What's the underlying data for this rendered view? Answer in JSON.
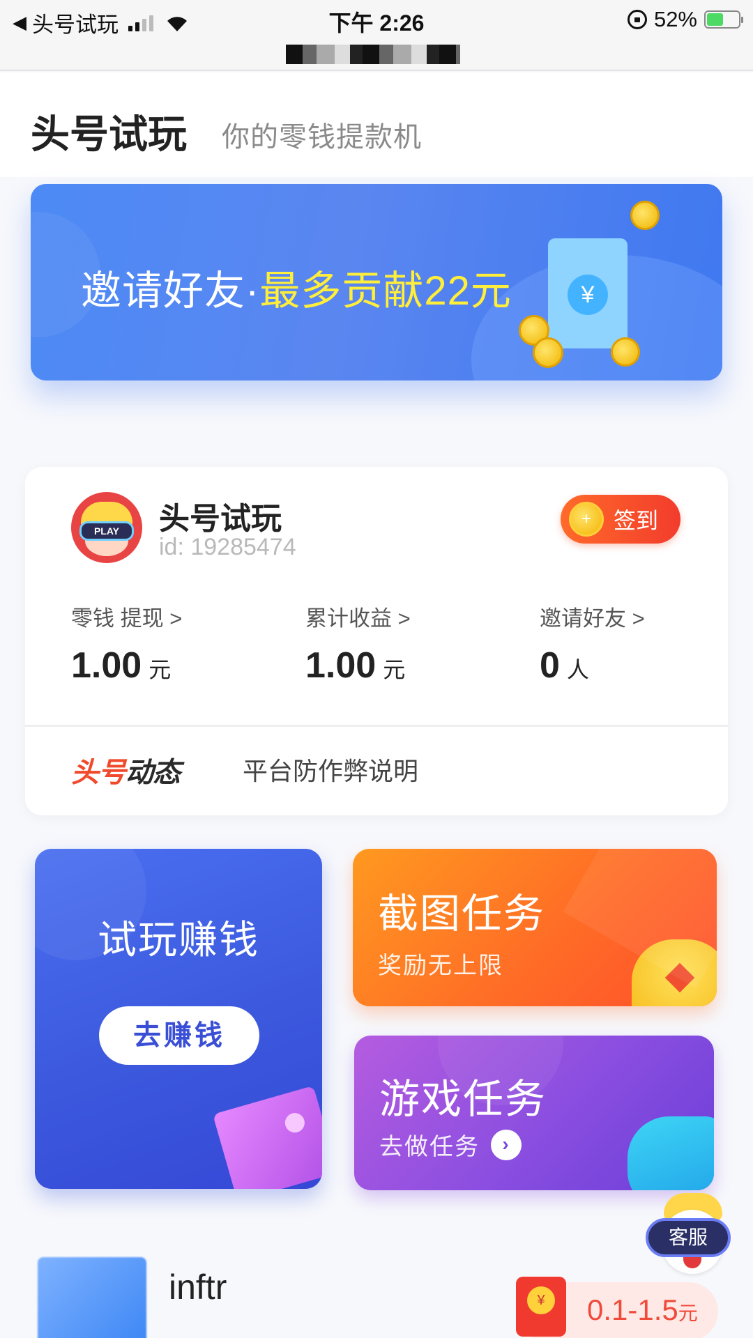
{
  "status_bar": {
    "back_app": "头号试玩",
    "time": "下午 2:26",
    "battery": "52%",
    "battery_level": 0.52
  },
  "header": {
    "title": "头号试玩",
    "subtitle": "你的零钱提款机"
  },
  "banner": {
    "text_main": "邀请好友·",
    "text_highlight": "最多贡献22元",
    "yen_symbol": "¥"
  },
  "user": {
    "name": "头号试玩",
    "id": "id: 19285474",
    "avatar_text": "PLAY",
    "signin_label": "签到"
  },
  "stats": [
    {
      "label": "零钱 提现 >",
      "value": "1.00",
      "unit": "元"
    },
    {
      "label": "累计收益 >",
      "value": "1.00",
      "unit": "元"
    },
    {
      "label": "邀请好友 >",
      "value": "0",
      "unit": "人"
    }
  ],
  "news": {
    "tag_red": "头号",
    "tag_dark": "动态",
    "text": "平台防作弊说明"
  },
  "tiles": {
    "try": {
      "title": "试玩赚钱",
      "button": "去赚钱"
    },
    "screenshot": {
      "title": "截图任务",
      "subtitle": "奖励无上限"
    },
    "game": {
      "title": "游戏任务",
      "subtitle": "去做任务",
      "arrow": "›"
    }
  },
  "customer_service": {
    "label": "客服"
  },
  "list": [
    {
      "title": "inftr",
      "reward": "0.1-1.5",
      "reward_unit": "元"
    }
  ],
  "colors": {
    "banner_blue": "#4d8af5",
    "highlight_yellow": "#ffee3a",
    "signin_red": "#f23c2c",
    "try_blue": "#3b57dc",
    "screenshot_orange": "#ff6d26",
    "game_purple": "#8a4ee0"
  }
}
